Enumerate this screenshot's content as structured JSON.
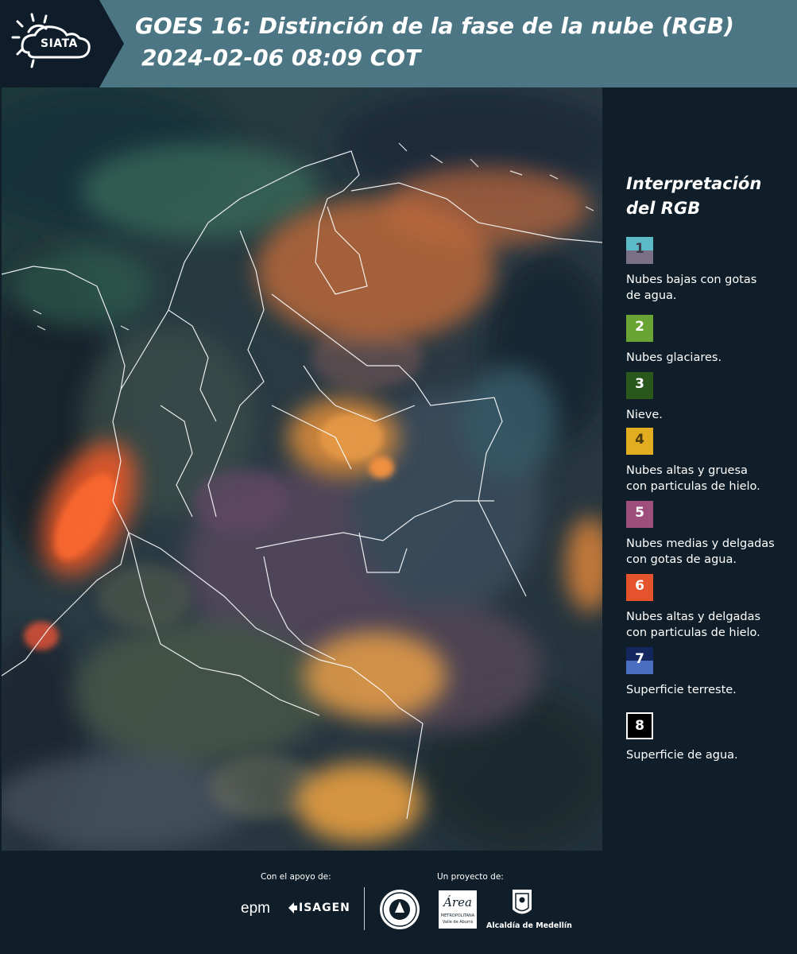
{
  "header": {
    "logo_text": "SIATA",
    "title_line1": "GOES 16: Distinción de la fase de la nube (RGB)",
    "title_line2": "2024-02-06 08:09 COT",
    "background": "#4d7684"
  },
  "map": {
    "type": "GOES-16 satellite RGB composite image (Colombia region)"
  },
  "legend": {
    "title_line1": "Interpretación",
    "title_line2": "del RGB",
    "items": [
      {
        "num": "1",
        "label_lines": [
          "Nubes bajas con gotas",
          "de agua."
        ],
        "color_top": "#5cbac6",
        "color_bottom": "#796f87",
        "num_color": "#3b3b4a"
      },
      {
        "num": "2",
        "label_lines": [
          "Nubes glaciares."
        ],
        "color": "#6aa434",
        "num_color": "#ffffff"
      },
      {
        "num": "3",
        "label_lines": [
          "Nieve."
        ],
        "color": "#2a581c",
        "num_color": "#ffffff"
      },
      {
        "num": "4",
        "label_lines": [
          "Nubes altas y gruesa",
          "con particulas de hielo."
        ],
        "color": "#e2ad21",
        "num_color": "#4a3a10"
      },
      {
        "num": "5",
        "label_lines": [
          "Nubes medias y delgadas",
          "con gotas de agua."
        ],
        "color": "#9e4e7d",
        "num_color": "#ffffff"
      },
      {
        "num": "6",
        "label_lines": [
          "Nubes altas y delgadas",
          "con particulas de hielo."
        ],
        "color": "#e4532c",
        "num_color": "#ffffff"
      },
      {
        "num": "7",
        "label_lines": [
          "Superficie terreste."
        ],
        "color_top": "#13265e",
        "color_bottom": "#4a6fc1",
        "num_color": "#ffffff"
      },
      {
        "num": "8",
        "label_lines": [
          "Superficie de agua."
        ],
        "color": "#000000",
        "border": "#ffffff",
        "num_color": "#ffffff"
      }
    ]
  },
  "footer": {
    "support_label": "Con el apoyo de:",
    "project_label": "Un proyecto de:",
    "sponsor1": "epm",
    "sponsor2": "ISAGEN",
    "partner_metro_name": "Área",
    "partner_metro_line1": "METROPOLITANA",
    "partner_metro_line2": "Valle de Aburrá",
    "partner_alcaldia": "Alcaldía de Medellín"
  }
}
